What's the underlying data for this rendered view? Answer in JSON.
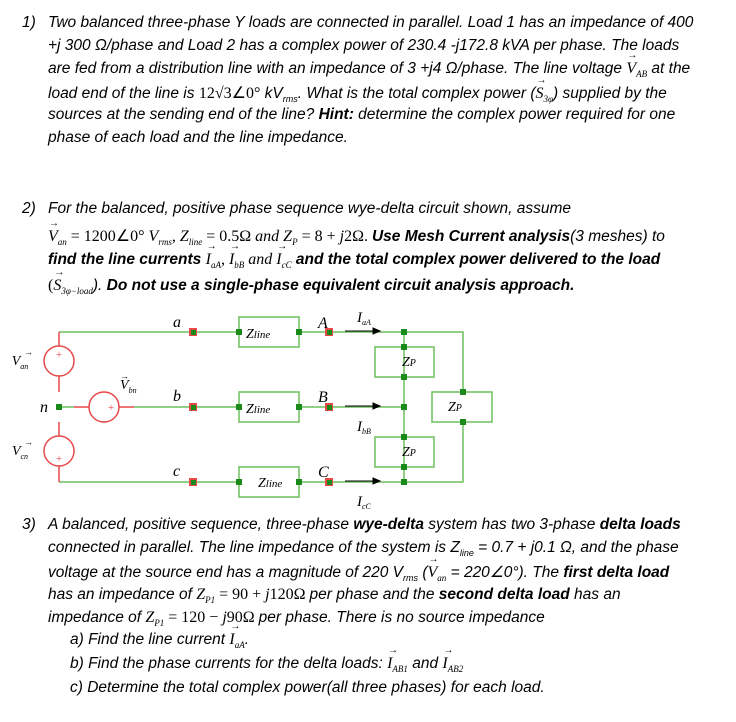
{
  "q1": {
    "number": "1)",
    "lines": [
      [
        {
          "t": "Two balanced three-phase Y loads are connected in parallel.  Load 1 has an impedance of 400"
        }
      ],
      [
        {
          "t": "+j 300 Ω/phase and Load 2 has a complex power of 230.4 -j172.8 kVA per phase.  The loads"
        }
      ],
      [
        {
          "t": "are fed from a distribution line with an impedance of 3 +j4 Ω/phase.  The line voltage "
        },
        {
          "t": "V",
          "m": 1,
          "vec": 1,
          "sub": "AB"
        },
        {
          "t": " at the"
        }
      ],
      [
        {
          "t": "load end of the line is "
        },
        {
          "t": "12√3∠0°",
          "r": 1
        },
        {
          "t": " kV"
        },
        {
          "t": "",
          "sub": "rms"
        },
        {
          "t": ".  What is the total complex power ("
        },
        {
          "t": "S",
          "m": 1,
          "vec": 1,
          "sub": "3φ"
        },
        {
          "t": ") supplied by the"
        }
      ],
      [
        {
          "t": "sources at the sending end of the line? "
        },
        {
          "t": "Hint:",
          "b": 1
        },
        {
          "t": " determine the complex power required for one"
        }
      ],
      [
        {
          "t": "phase of each load and the line impedance."
        }
      ]
    ]
  },
  "q2": {
    "number": "2)",
    "lines": [
      [
        {
          "t": "For the balanced, positive phase sequence wye-delta circuit shown, assume"
        }
      ],
      [
        {
          "t": "V",
          "m": 1,
          "vec": 1,
          "sub": "an"
        },
        {
          "t": " = 1200∠0° ",
          "r": 1
        },
        {
          "t": "V",
          "m": 1,
          "sub": "rms"
        },
        {
          "t": ", ",
          "r": 1
        },
        {
          "t": "Z",
          "m": 1,
          "sub": "line"
        },
        {
          "t": " = 0.5Ω ",
          "r": 1
        },
        {
          "t": "and Z",
          "m": 1,
          "sub": "P"
        },
        {
          "t": " = 8 + ",
          "r": 1
        },
        {
          "t": "j",
          "m": 1
        },
        {
          "t": "2Ω.  ",
          "r": 1
        },
        {
          "t": "Use Mesh Current analysis",
          "b": 1
        },
        {
          "t": "(3 meshes) to"
        }
      ],
      [
        {
          "t": "find the line currents ",
          "b": 1
        },
        {
          "t": "I",
          "m": 1,
          "vec": 1,
          "sub": "aA"
        },
        {
          "t": ", ",
          "r": 1
        },
        {
          "t": "I",
          "m": 1,
          "vec": 1,
          "sub": "bB"
        },
        {
          "t": " and ",
          "m": 1
        },
        {
          "t": "I",
          "m": 1,
          "vec": 1,
          "sub": "cC"
        },
        {
          "t": "  and the total complex power delivered to the load",
          "b": 1
        }
      ],
      [
        {
          "t": "(",
          "r": 1
        },
        {
          "t": "S",
          "m": 1,
          "vec": 1,
          "sub": "3φ−load"
        },
        {
          "t": "). "
        },
        {
          "t": " Do not use a single-phase equivalent circuit analysis approach.",
          "b": 1
        }
      ]
    ]
  },
  "circuit": {
    "node_labels": {
      "a": "a",
      "b": "b",
      "c": "c",
      "A": "A",
      "B": "B",
      "C": "C",
      "n": "n"
    },
    "sources": [
      "V_an",
      "V_bn",
      "V_cn"
    ],
    "source_labels": {
      "an": "an",
      "bn": "bn",
      "cn": "cn",
      "V": "V",
      "plus": "+"
    },
    "current_labels": {
      "I": "I",
      "aA": "aA",
      "bB": "bB",
      "cC": "cC"
    },
    "zline": {
      "Z": "Z",
      "sub": "line"
    },
    "zp": {
      "Z": "Z",
      "sub": "P"
    },
    "colors": {
      "wire": "#6fbf5f",
      "source": "#e8484a",
      "node": "#1a8a1a",
      "terminal": "#e8484a"
    }
  },
  "q3": {
    "number": "3)",
    "lines": [
      [
        {
          "t": "A balanced, positive sequence, three-phase "
        },
        {
          "t": "wye-delta",
          "b": 1
        },
        {
          "t": " system has two 3-phase "
        },
        {
          "t": "delta loads",
          "b": 1
        }
      ],
      [
        {
          "t": "connected in parallel.  The line impedance of the system is Z"
        },
        {
          "t": "",
          "sub": "line"
        },
        {
          "t": " = 0.7 + j0.1 Ω, and the phase"
        }
      ],
      [
        {
          "t": "voltage at the source end has a magnitude of 220 V"
        },
        {
          "t": "",
          "sub": "rms"
        },
        {
          "t": " ("
        },
        {
          "t": "V",
          "m": 1,
          "vec": 1,
          "sub": "an"
        },
        {
          "t": " = 220∠0°).  The "
        },
        {
          "t": "first delta load",
          "b": 1
        }
      ],
      [
        {
          "t": "has an impedance of "
        },
        {
          "t": "Z",
          "m": 1,
          "sub": "P1"
        },
        {
          "t": " = 90 + ",
          "r": 1
        },
        {
          "t": "j",
          "m": 1
        },
        {
          "t": "120Ω ",
          "r": 1
        },
        {
          "t": " per phase and the "
        },
        {
          "t": "second delta load",
          "b": 1
        },
        {
          "t": " has an"
        }
      ],
      [
        {
          "t": "impedance of "
        },
        {
          "t": "Z",
          "m": 1,
          "sub": "P1"
        },
        {
          "t": " = 120 − ",
          "r": 1
        },
        {
          "t": "j",
          "m": 1
        },
        {
          "t": "90Ω ",
          "r": 1
        },
        {
          "t": " per phase.  There is no source impedance"
        }
      ]
    ],
    "parts": [
      [
        {
          "t": "a)  Find the line current "
        },
        {
          "t": "I",
          "m": 1,
          "vec": 1,
          "sub": "aA"
        },
        {
          "t": "."
        }
      ],
      [
        {
          "t": "b)  Find the phase currents for the delta loads: "
        },
        {
          "t": "I",
          "m": 1,
          "vec": 1,
          "sub": "AB1"
        },
        {
          "t": "  and "
        },
        {
          "t": "I",
          "m": 1,
          "vec": 1,
          "sub": "AB2"
        }
      ],
      [
        {
          "t": "c)  Determine the total complex power(all three phases) for each load."
        }
      ]
    ]
  }
}
